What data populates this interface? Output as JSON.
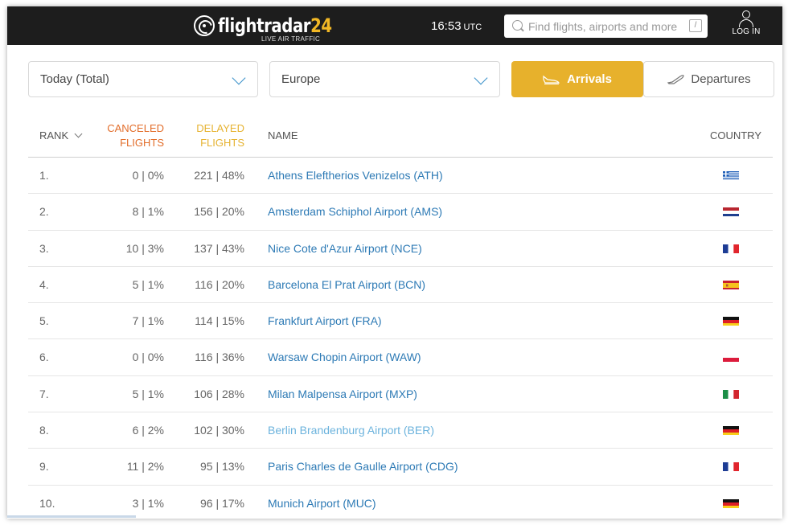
{
  "header": {
    "logo_text": "flightradar",
    "logo_number": "24",
    "logo_sub": "LIVE AIR TRAFFIC",
    "clock_time": "16:53",
    "clock_zone": "UTC",
    "search_placeholder": "Find flights, airports and more",
    "search_shortcut": "/",
    "login_label": "LOG IN"
  },
  "filters": {
    "period": "Today (Total)",
    "region": "Europe",
    "arrivals_label": "Arrivals",
    "departures_label": "Departures",
    "active": "Arrivals"
  },
  "table": {
    "columns": {
      "rank": "RANK",
      "canceled": [
        "CANCELED",
        "FLIGHTS"
      ],
      "delayed": [
        "DELAYED",
        "FLIGHTS"
      ],
      "name": "NAME",
      "country": "COUNTRY"
    },
    "rows": [
      {
        "rank": "1.",
        "canceled": "0 | 0%",
        "delayed": "221 | 48%",
        "name": "Athens Eleftherios Venizelos (ATH)",
        "flag": "greece-flag"
      },
      {
        "rank": "2.",
        "canceled": "8 | 1%",
        "delayed": "156 | 20%",
        "name": "Amsterdam Schiphol Airport (AMS)",
        "flag": "netherlands-flag"
      },
      {
        "rank": "3.",
        "canceled": "10 | 3%",
        "delayed": "137 | 43%",
        "name": "Nice Cote d'Azur Airport (NCE)",
        "flag": "france-flag"
      },
      {
        "rank": "4.",
        "canceled": "5 | 1%",
        "delayed": "116 | 20%",
        "name": "Barcelona El Prat Airport (BCN)",
        "flag": "spain-flag"
      },
      {
        "rank": "5.",
        "canceled": "7 | 1%",
        "delayed": "114 | 15%",
        "name": "Frankfurt Airport (FRA)",
        "flag": "germany-flag"
      },
      {
        "rank": "6.",
        "canceled": "0 | 0%",
        "delayed": "116 | 36%",
        "name": "Warsaw Chopin Airport (WAW)",
        "flag": "poland-flag"
      },
      {
        "rank": "7.",
        "canceled": "5 | 1%",
        "delayed": "106 | 28%",
        "name": "Milan Malpensa Airport (MXP)",
        "flag": "italy-flag"
      },
      {
        "rank": "8.",
        "canceled": "6 | 2%",
        "delayed": "102 | 30%",
        "name": "Berlin Brandenburg Airport (BER)",
        "flag": "germany-flag"
      },
      {
        "rank": "9.",
        "canceled": "11 | 2%",
        "delayed": "95 | 13%",
        "name": "Paris Charles de Gaulle Airport (CDG)",
        "flag": "france-flag"
      },
      {
        "rank": "10.",
        "canceled": "3 | 1%",
        "delayed": "96 | 17%",
        "name": "Munich Airport (MUC)",
        "flag": "germany-flag"
      }
    ]
  },
  "colors": {
    "topbar": "#1d1d1d",
    "accent_yellow": "#e7b12c",
    "canceled_header": "#e26d2a",
    "delayed_header": "#e6b332",
    "link_blue": "#2d7ab5",
    "link_hover": "#6cb3dd"
  }
}
